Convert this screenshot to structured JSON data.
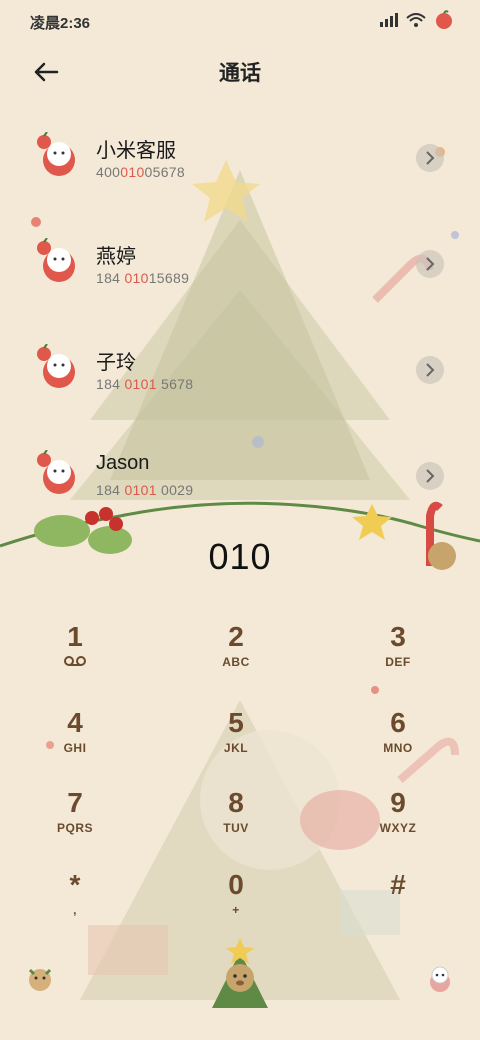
{
  "status": {
    "time": "凌晨2:36"
  },
  "header": {
    "title": "通话"
  },
  "contacts": [
    {
      "name": "小米客服",
      "pre": "400",
      "hl": "010",
      "post": "05678"
    },
    {
      "name": "燕婷",
      "pre": "184 ",
      "hl": "010",
      "post": "15689"
    },
    {
      "name": "子玲",
      "pre": "184 ",
      "hl": "0101",
      "post": " 5678"
    },
    {
      "name": "Jason",
      "pre": "184 ",
      "hl": "0101",
      "post": " 0029"
    }
  ],
  "dial": {
    "number": "010"
  },
  "keys": [
    {
      "digit": "1",
      "letters": ""
    },
    {
      "digit": "2",
      "letters": "ABC"
    },
    {
      "digit": "3",
      "letters": "DEF"
    },
    {
      "digit": "4",
      "letters": "GHI"
    },
    {
      "digit": "5",
      "letters": "JKL"
    },
    {
      "digit": "6",
      "letters": "MNO"
    },
    {
      "digit": "7",
      "letters": "PQRS"
    },
    {
      "digit": "8",
      "letters": "TUV"
    },
    {
      "digit": "9",
      "letters": "WXYZ"
    },
    {
      "digit": "*",
      "letters": ","
    },
    {
      "digit": "0",
      "letters": "+"
    },
    {
      "digit": "#",
      "letters": ""
    }
  ],
  "colors": {
    "accent": "#e0574b",
    "keypad_text": "#6b4a2e",
    "background": "#f3e9d6"
  },
  "icons": [
    "back-arrow-icon",
    "signal-icon",
    "wifi-icon",
    "battery-icon",
    "voicemail-icon",
    "chevron-right-icon",
    "call-button-icon",
    "menu-icon",
    "contacts-icon"
  ]
}
